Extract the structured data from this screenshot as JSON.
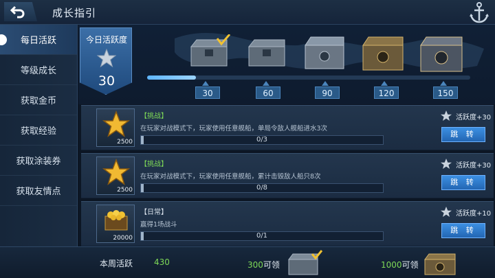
{
  "header": {
    "title": "成长指引",
    "back_icon": "back-arrow-icon",
    "menu_icon": "anchor-icon"
  },
  "sidebar": {
    "items": [
      {
        "label": "每日活跃",
        "active": true
      },
      {
        "label": "等级成长",
        "active": false
      },
      {
        "label": "获取金币",
        "active": false
      },
      {
        "label": "获取经验",
        "active": false
      },
      {
        "label": "获取涂装券",
        "active": false
      },
      {
        "label": "获取友情点",
        "active": false
      }
    ]
  },
  "daily": {
    "label": "今日活跃度",
    "value": "30",
    "progress_fraction": 0.15,
    "milestones": [
      {
        "value": "30",
        "claimed": true
      },
      {
        "value": "60",
        "claimed": false
      },
      {
        "value": "90",
        "claimed": false
      },
      {
        "value": "120",
        "claimed": false
      },
      {
        "value": "150",
        "claimed": false
      }
    ]
  },
  "tasks": [
    {
      "tag": "【挑战】",
      "tag_color": "#7ed957",
      "description": "在玩家对战模式下，玩家使用任意舰船，单局令敌人舰船进水3次",
      "icon": "gold-star-icon",
      "icon_count": "2500",
      "progress_text": "0/3",
      "reward": "活跃度+30",
      "button": "跳 转"
    },
    {
      "tag": "【挑战】",
      "tag_color": "#7ed957",
      "description": "在玩家对战模式下，玩家使用任意舰船，累计击毁敌人船只8次",
      "icon": "gold-star-icon",
      "icon_count": "2500",
      "progress_text": "0/8",
      "reward": "活跃度+30",
      "button": "跳 转"
    },
    {
      "tag": "【日常】",
      "tag_color": "#dbe4ee",
      "description": "赢得1场战斗",
      "icon": "gold-coins-chest-icon",
      "icon_count": "20000",
      "progress_text": "0/1",
      "reward": "活跃度+10",
      "button": "跳 转"
    }
  ],
  "footer": {
    "week_label": "本周活跃",
    "week_value": "430",
    "rewards": [
      {
        "value": "300",
        "suffix": "可领"
      },
      {
        "value": "1000",
        "suffix": "可领"
      }
    ]
  },
  "colors": {
    "accent": "#3c8fe2",
    "highlight": "#7ed957",
    "panel": "#1b2c42"
  }
}
